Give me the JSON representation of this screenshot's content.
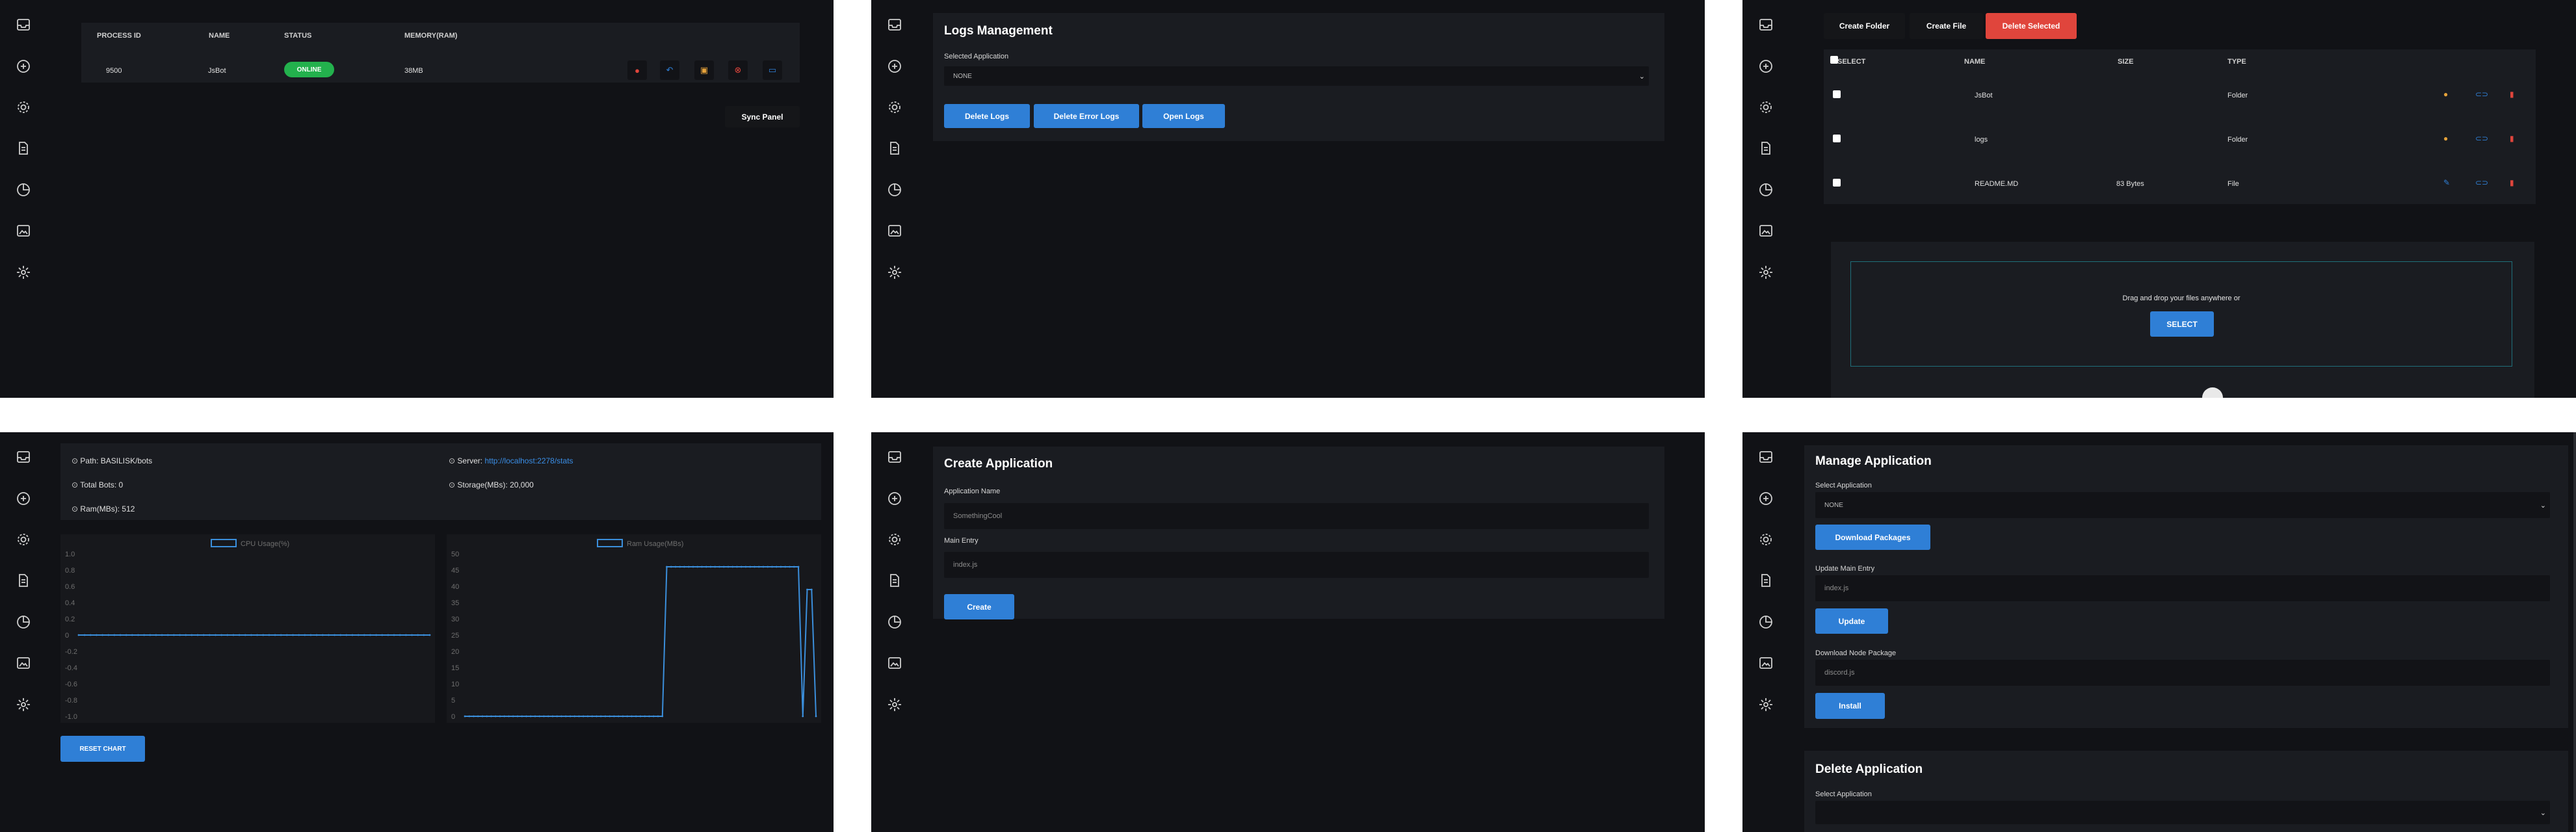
{
  "sidebar_icons": [
    "inbox-icon",
    "plus-circle-icon",
    "gear-icon",
    "document-icon",
    "clock-chart-icon",
    "image-icon",
    "sun-icon"
  ],
  "process_panel": {
    "headers": [
      "PROCESS ID",
      "NAME",
      "STATUS",
      "MEMORY(RAM)"
    ],
    "row": {
      "pid": "9500",
      "name": "JsBot",
      "status": "ONLINE",
      "memory": "38MB"
    },
    "sync_label": "Sync Panel"
  },
  "logs_panel": {
    "title": "Logs Management",
    "select_label": "Selected Application",
    "select_value": "NONE",
    "buttons": {
      "delete_logs": "Delete Logs",
      "delete_error_logs": "Delete Error Logs",
      "open_logs": "Open Logs"
    }
  },
  "files_panel": {
    "buttons": {
      "create_folder": "Create Folder",
      "create_file": "Create File",
      "delete_selected": "Delete Selected"
    },
    "headers": {
      "select": "SELECT",
      "name": "NAME",
      "size": "SIZE",
      "type": "TYPE"
    },
    "rows": [
      {
        "name": "JsBot",
        "size": "",
        "type": "Folder"
      },
      {
        "name": "logs",
        "size": "",
        "type": "Folder"
      },
      {
        "name": "README.MD",
        "size": "83 Bytes",
        "type": "File"
      }
    ],
    "drop_text": "Drag and drop your files anywhere or",
    "select_button": "SELECT"
  },
  "stats_panel": {
    "path_label": "Path:",
    "path_value": "BASILISK/bots",
    "server_label": "Server:",
    "server_value": "http://localhost:2278/stats",
    "total_bots": "Total Bots: 0",
    "storage": "Storage(MBs): 20,000",
    "ram": "Ram(MBs): 512",
    "reset_button": "RESET CHART"
  },
  "create_panel": {
    "title": "Create Application",
    "name_label": "Application Name",
    "name_placeholder": "SomethingCool",
    "entry_label": "Main Entry",
    "entry_placeholder": "index.js",
    "create_button": "Create"
  },
  "manage_panel": {
    "title": "Manage Application",
    "select_label": "Select Application",
    "select_value": "NONE",
    "download_button": "Download Packages",
    "entry_label": "Update Main Entry",
    "entry_placeholder": "index.js",
    "update_button": "Update",
    "node_label": "Download Node Package",
    "node_placeholder": "discord.js",
    "install_button": "Install",
    "delete_title": "Delete Application",
    "delete_select_label": "Select Application"
  },
  "colors": {
    "accent": "#2f7fd6",
    "danger": "#e0453c",
    "online": "#23b14d",
    "background": "#111216",
    "card": "#1a1c21"
  },
  "chart_data": [
    {
      "type": "line",
      "series": [
        {
          "name": "CPU Usage(%)",
          "values": [
            0,
            0,
            0,
            0,
            0,
            0,
            0,
            0,
            0,
            0,
            0,
            0,
            0,
            0,
            0,
            0,
            0,
            0,
            0,
            0,
            0,
            0,
            0,
            0,
            0,
            0,
            0,
            0,
            0,
            0,
            0,
            0,
            0,
            0,
            0,
            0,
            0,
            0,
            0,
            0,
            0,
            0,
            0,
            0,
            0,
            0,
            0,
            0,
            0,
            0,
            0,
            0,
            0,
            0,
            0,
            0,
            0,
            0,
            0,
            0
          ]
        }
      ],
      "ylim": [
        -1.0,
        1.0
      ],
      "yticks": [
        "1.0",
        "0.8",
        "0.6",
        "0.4",
        "0.2",
        "0",
        "-0.2",
        "-0.4",
        "-0.6",
        "-0.8",
        "-1.0"
      ]
    },
    {
      "type": "line",
      "series": [
        {
          "name": "Ram Usage(MBs)",
          "values": [
            0,
            0,
            0,
            0,
            0,
            0,
            0,
            0,
            0,
            0,
            0,
            0,
            0,
            0,
            0,
            0,
            0,
            0,
            0,
            0,
            0,
            0,
            0,
            0,
            0,
            0,
            0,
            0,
            0,
            0,
            0,
            0,
            0,
            0,
            0,
            0,
            0,
            0,
            0,
            0,
            0,
            0,
            0,
            0,
            0,
            0,
            46,
            46,
            46,
            46,
            46,
            46,
            46,
            46,
            46,
            46,
            46,
            46,
            46,
            46,
            46,
            46,
            46,
            46,
            46,
            46,
            46,
            46,
            46,
            46,
            46,
            46,
            46,
            46,
            46,
            46,
            46,
            0,
            39,
            39,
            0
          ]
        }
      ],
      "ylim": [
        0,
        50
      ],
      "yticks": [
        "50",
        "45",
        "40",
        "35",
        "30",
        "25",
        "20",
        "15",
        "10",
        "5",
        "0"
      ]
    }
  ]
}
